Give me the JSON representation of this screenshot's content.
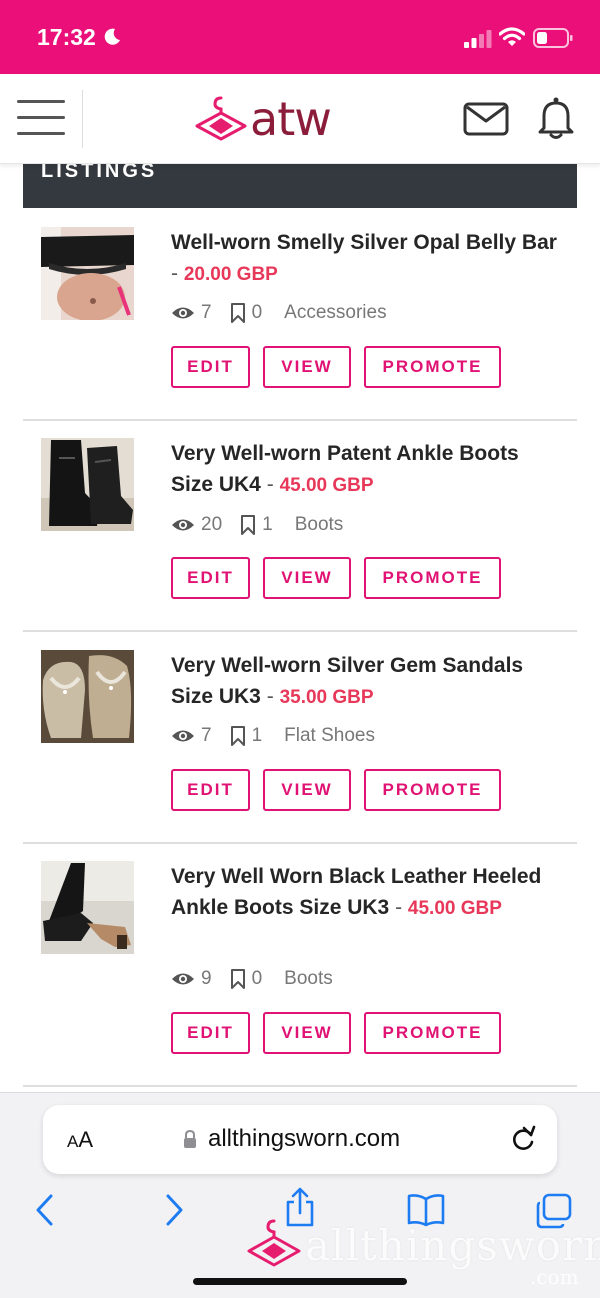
{
  "status_bar": {
    "time": "17:32"
  },
  "header": {
    "logo_text": "atw"
  },
  "section": {
    "title": "LISTINGS"
  },
  "listings": [
    {
      "title": "Well-worn Smelly Silver Opal Belly Bar",
      "separator": "-",
      "price": "20.00 GBP",
      "views": "7",
      "saves": "0",
      "category": "Accessories",
      "buttons": {
        "edit": "EDIT",
        "view": "VIEW",
        "promote": "PROMOTE"
      }
    },
    {
      "title": "Very Well-worn Patent Ankle Boots Size UK4",
      "separator": "-",
      "price": "45.00 GBP",
      "views": "20",
      "saves": "1",
      "category": "Boots",
      "buttons": {
        "edit": "EDIT",
        "view": "VIEW",
        "promote": "PROMOTE"
      }
    },
    {
      "title": "Very Well-worn Silver Gem Sandals Size UK3",
      "separator": "-",
      "price": "35.00 GBP",
      "views": "7",
      "saves": "1",
      "category": "Flat Shoes",
      "buttons": {
        "edit": "EDIT",
        "view": "VIEW",
        "promote": "PROMOTE"
      }
    },
    {
      "title": "Very Well Worn Black Leather Heeled Ankle Boots Size UK3",
      "separator": "-",
      "price": "45.00 GBP",
      "views": "9",
      "saves": "0",
      "category": "Boots",
      "buttons": {
        "edit": "EDIT",
        "view": "VIEW",
        "promote": "PROMOTE"
      }
    }
  ],
  "browser": {
    "text_size_label_small": "A",
    "text_size_label_large": "A",
    "url": "allthingsworn.com"
  },
  "watermark": {
    "text": "allthingsworn",
    "suffix": ".com"
  },
  "colors": {
    "brand_pink": "#ea0f79",
    "button_pink": "#e01274",
    "price_red": "#e8385a",
    "logo_maroon": "#8b1d3b",
    "section_bar": "#34393f"
  }
}
